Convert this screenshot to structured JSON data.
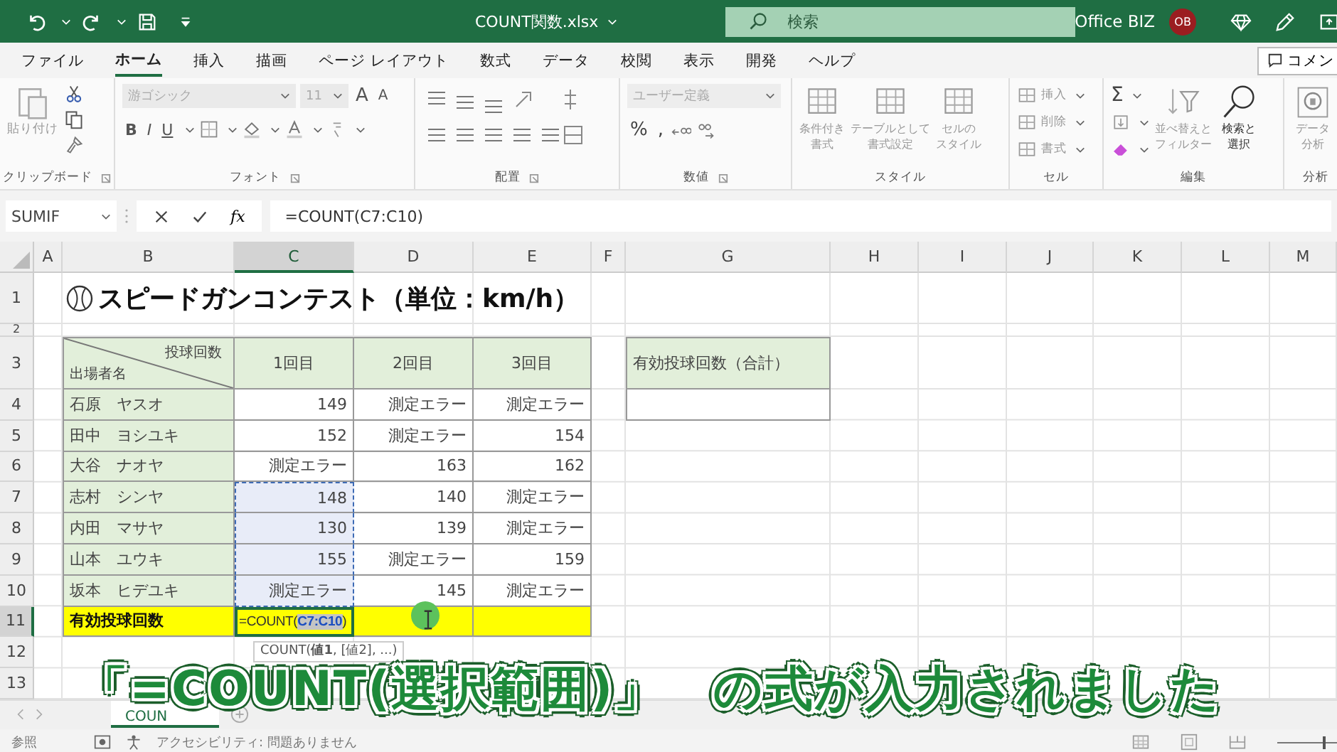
{
  "title_bar": {
    "file_name": "COUNT関数.xlsx",
    "search": {
      "placeholder": "検索"
    },
    "account": "Office BIZ",
    "avatar": "OB"
  },
  "menu_tabs": [
    {
      "label": "ファイル",
      "selected": false
    },
    {
      "label": "ホーム",
      "selected": true
    },
    {
      "label": "挿入",
      "selected": false
    },
    {
      "label": "描画",
      "selected": false
    },
    {
      "label": "ページ レイアウト",
      "selected": false
    },
    {
      "label": "数式",
      "selected": false
    },
    {
      "label": "データ",
      "selected": false
    },
    {
      "label": "校閲",
      "selected": false
    },
    {
      "label": "表示",
      "selected": false
    },
    {
      "label": "開発",
      "selected": false
    },
    {
      "label": "ヘルプ",
      "selected": false
    }
  ],
  "comment_button": "コメン",
  "ribbon": {
    "groups": [
      {
        "kind": "clipboard",
        "label": "クリップボード",
        "paste": "貼り付け"
      },
      {
        "kind": "font",
        "label": "フォント",
        "font_name": "游ゴシック",
        "font_size": "11",
        "grow": "A",
        "shrink": "A",
        "bold": "B",
        "italic": "I",
        "underline": "U"
      },
      {
        "kind": "alignment",
        "label": "配置"
      },
      {
        "kind": "number",
        "label": "数値",
        "format": "ユーザー定義",
        "percent": "%",
        "comma": ","
      },
      {
        "kind": "styles",
        "label": "スタイル",
        "buttons": [
          {
            "lines": [
              "条件付き",
              "書式"
            ]
          },
          {
            "lines": [
              "テーブルとして",
              "書式設定"
            ]
          },
          {
            "lines": [
              "セルの",
              "スタイル"
            ]
          }
        ]
      },
      {
        "kind": "cells",
        "label": "セル",
        "buttons": [
          "挿入",
          "削除",
          "書式"
        ]
      },
      {
        "kind": "editing",
        "label": "編集",
        "sigma": "Σ",
        "buttons": [
          {
            "lines": [
              "並べ替えと",
              "フィルター"
            ]
          },
          {
            "lines": [
              "検索と",
              "選択"
            ]
          }
        ]
      },
      {
        "kind": "analysis",
        "label": "分析",
        "buttons": [
          {
            "lines": [
              "データ",
              "分析"
            ]
          }
        ]
      }
    ]
  },
  "formula_bar": {
    "name_box": "SUMIF",
    "fx": "fx",
    "formula": "=COUNT(C7:C10)"
  },
  "sheet": {
    "columns": [
      {
        "label": "A",
        "selected": false
      },
      {
        "label": "B",
        "selected": false
      },
      {
        "label": "C",
        "selected": true
      },
      {
        "label": "D",
        "selected": false
      },
      {
        "label": "E",
        "selected": false
      },
      {
        "label": "F",
        "selected": false
      },
      {
        "label": "G",
        "selected": false
      },
      {
        "label": "H",
        "selected": false
      },
      {
        "label": "I",
        "selected": false
      },
      {
        "label": "J",
        "selected": false
      },
      {
        "label": "K",
        "selected": false
      },
      {
        "label": "L",
        "selected": false
      },
      {
        "label": "M",
        "selected": false
      }
    ],
    "rows": [
      {
        "label": "1",
        "selected": false
      },
      {
        "label": "2",
        "selected": false
      },
      {
        "label": "3",
        "selected": false
      },
      {
        "label": "4",
        "selected": false
      },
      {
        "label": "5",
        "selected": false
      },
      {
        "label": "6",
        "selected": false
      },
      {
        "label": "7",
        "selected": false
      },
      {
        "label": "8",
        "selected": false
      },
      {
        "label": "9",
        "selected": false
      },
      {
        "label": "10",
        "selected": false
      },
      {
        "label": "11",
        "selected": true
      },
      {
        "label": "12",
        "selected": false
      },
      {
        "label": "13",
        "selected": false
      }
    ],
    "title": "スピードガンコンテスト（単位：km/h）",
    "table": {
      "corner_top": "投球回数",
      "corner_bottom": "出場者名",
      "headers": [
        "1回目",
        "2回目",
        "3回目"
      ],
      "rows": [
        {
          "name": "石原　ヤスオ",
          "values": [
            "149",
            "測定エラー",
            "測定エラー"
          ],
          "in_range": false
        },
        {
          "name": "田中　ヨシユキ",
          "values": [
            "152",
            "測定エラー",
            "154"
          ],
          "in_range": false
        },
        {
          "name": "大谷　ナオヤ",
          "values": [
            "測定エラー",
            "163",
            "162"
          ],
          "in_range": false
        },
        {
          "name": "志村　シンヤ",
          "values": [
            "148",
            "140",
            "測定エラー"
          ],
          "in_range": true
        },
        {
          "name": "内田　マサヤ",
          "values": [
            "130",
            "139",
            "測定エラー"
          ],
          "in_range": true
        },
        {
          "name": "山本　ユウキ",
          "values": [
            "155",
            "測定エラー",
            "159"
          ],
          "in_range": true
        },
        {
          "name": "坂本　ヒデユキ",
          "values": [
            "測定エラー",
            "145",
            "測定エラー"
          ],
          "in_range": true
        }
      ],
      "total": {
        "label": "有効投球回数",
        "formula_start": "=COUNT(",
        "formula_reference": "C7:C10",
        "formula_end": ")"
      }
    },
    "summary_header": "有効投球回数（合計）",
    "tooltip": "COUNT(**値1**, [値2], ...)"
  },
  "sheet_tabs": [
    {
      "label": "COUN",
      "selected": true
    }
  ],
  "status_bar": {
    "mode": "参照",
    "accessibility": "アクセシビリティ: 問題ありません",
    "zoom": {
      "level": 0.75
    }
  },
  "caption": "「=COUNT(選択範囲)」　の式が入力されました"
}
